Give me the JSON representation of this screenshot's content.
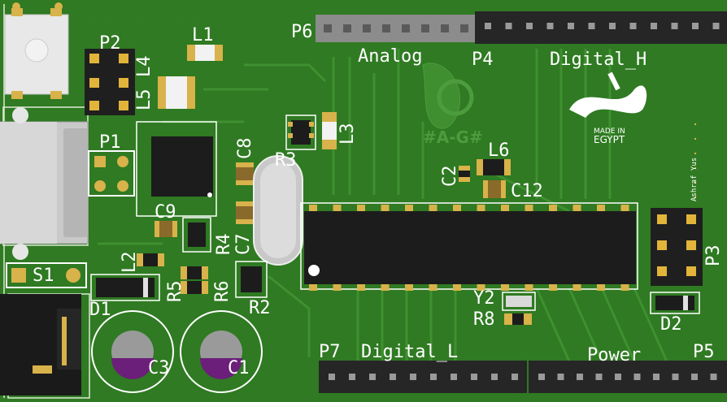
{
  "board": {
    "colors": {
      "pcb": "#2f7a22",
      "trace": "#3c8c2a",
      "silk": "#ffffff",
      "pad": "#d8b24a",
      "ic": "#1c1c1c",
      "header": "#262626",
      "cap_top": "#8a8a8a",
      "cap_band": "#6b1f7a"
    },
    "labels": {
      "p2": "P2",
      "l1": "L1",
      "l4": "L4",
      "l5": "L5",
      "p1": "P1",
      "c8": "C8",
      "l3": "L3",
      "r3": "R3",
      "p6": "P6",
      "analog": "Analog",
      "p4": "P4",
      "digital_h": "Digital_H",
      "made_in": "MADE IN",
      "egypt": "EGYPT",
      "logo_tag": "#A-G#",
      "c2": "C2",
      "l6": "L6",
      "c12": "C12",
      "c9": "C9",
      "r4": "R4",
      "c7": "C7",
      "l2": "L2",
      "s1": "S1",
      "r5": "R5",
      "r6": "R6",
      "r2": "R2",
      "d1": "D1",
      "c3": "C3",
      "c1": "C1",
      "p3": "P3",
      "y2": "Y2",
      "r8": "R8",
      "d2": "D2",
      "p7": "P7",
      "digital_l": "Digital_L",
      "power": "Power",
      "p5": "P5",
      "signature": "Ashraf Yus"
    }
  }
}
